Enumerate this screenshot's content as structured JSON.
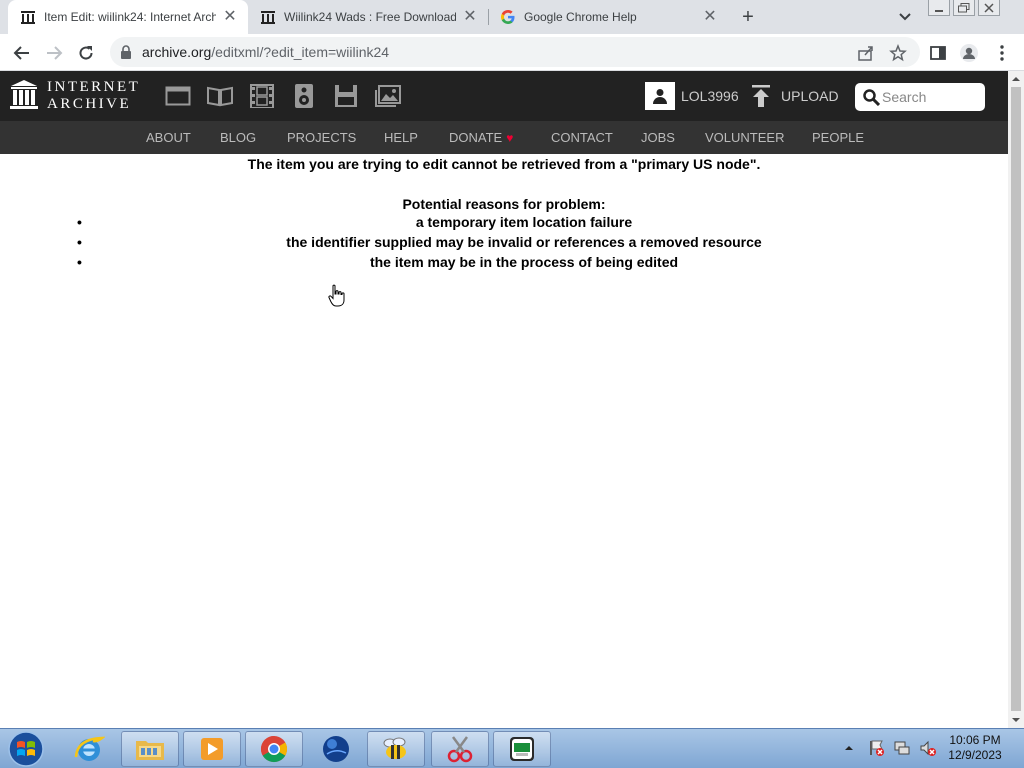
{
  "browser": {
    "tabs": [
      {
        "title": "Item Edit: wiilink24: Internet Arch",
        "favicon": "archive-favicon",
        "active": true
      },
      {
        "title": "Wiilink24 Wads : Free Download",
        "favicon": "archive-favicon",
        "active": false
      },
      {
        "title": "Google Chrome Help",
        "favicon": "google-favicon",
        "active": false
      }
    ],
    "url_host": "archive.org",
    "url_path": "/editxml/?edit_item=wiilink24"
  },
  "ia_header": {
    "logo_line1": "INTERNET",
    "logo_line2": "ARCHIVE",
    "media_icons": [
      "web-icon",
      "texts-icon",
      "video-icon",
      "audio-icon",
      "software-icon",
      "images-icon"
    ],
    "username": "LOL3996",
    "upload_label": "UPLOAD",
    "search_placeholder": "Search"
  },
  "ia_nav": {
    "items": [
      "ABOUT",
      "BLOG",
      "PROJECTS",
      "HELP",
      "DONATE",
      "CONTACT",
      "JOBS",
      "VOLUNTEER",
      "PEOPLE"
    ]
  },
  "content": {
    "error_message": "The item you are trying to edit cannot be retrieved from a \"primary US node\".",
    "reasons_heading": "Potential reasons for problem:",
    "reasons": [
      "a temporary item location failure",
      "the identifier supplied may be invalid or references a removed resource",
      "the item may be in the process of being edited"
    ]
  },
  "taskbar": {
    "apps": [
      "internet-explorer",
      "windows-explorer",
      "media-player",
      "google-chrome",
      "globe-app",
      "bee-app",
      "scissors-app",
      "wiilink-app"
    ],
    "time": "10:06 PM",
    "date": "12/9/2023"
  },
  "colors": {
    "ia_header_bg": "#222222",
    "ia_nav_bg": "#333333",
    "tabstrip_bg": "#dee1e6",
    "donate_heart": "#ee0033"
  }
}
